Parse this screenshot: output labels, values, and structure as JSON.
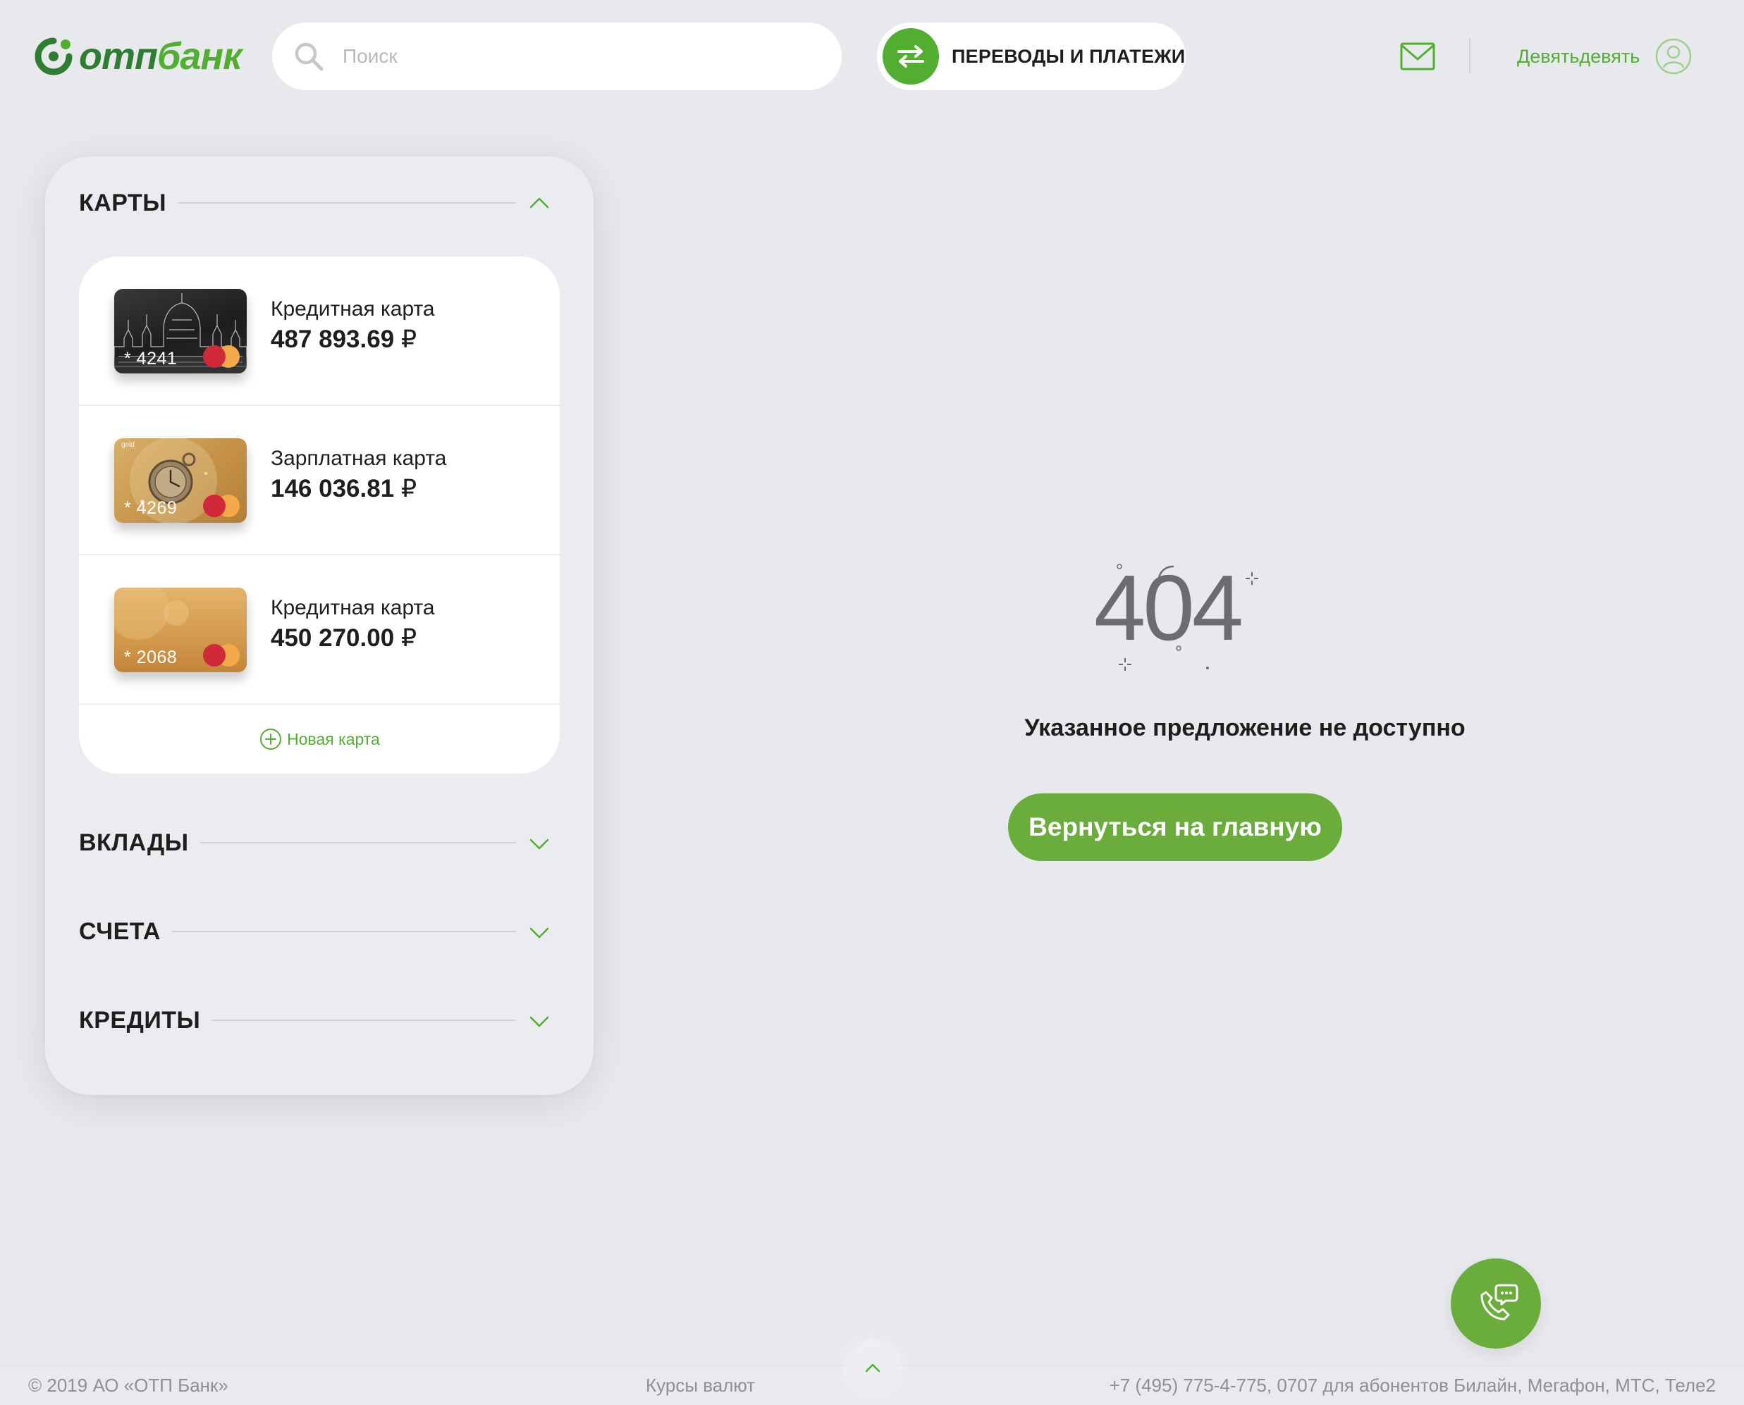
{
  "brand": {
    "logo_part1": "отп",
    "logo_part2": "банк",
    "green": "#52ae30",
    "dark_green": "#2e7d32"
  },
  "header": {
    "search_placeholder": "Поиск",
    "transfers_label": "ПЕРЕВОДЫ И ПЛАТЕЖИ",
    "user_name": "Девятьдевять",
    "icons": [
      "search-icon",
      "transfer-arrows-icon",
      "mail-icon",
      "user-avatar-icon"
    ]
  },
  "sidebar": {
    "cards_title": "КАРТЫ",
    "cards": [
      {
        "name": "Кредитная карта",
        "amount": "487 893.69",
        "currency": "₽",
        "number": "* 4241",
        "style": "dark-parliament"
      },
      {
        "name": "Зарплатная карта",
        "amount": "146 036.81",
        "currency": "₽",
        "number": "* 4269",
        "style": "gold-watch",
        "badge": "gold"
      },
      {
        "name": "Кредитная карта",
        "amount": "450 270.00",
        "currency": "₽",
        "number": "* 2068",
        "style": "gold-plain"
      }
    ],
    "new_card_label": "Новая карта",
    "deposits_title": "ВКЛАДЫ",
    "accounts_title": "СЧЕТА",
    "loans_title": "КРЕДИТЫ"
  },
  "main": {
    "error_code": "404",
    "message": "Указанное предложение не доступно",
    "home_button": "Вернуться на главную"
  },
  "footer": {
    "copyright": "© 2019 АО «ОТП Банк»",
    "rates_link": "Курсы валют",
    "phones": "+7 (495) 775-4-775,  0707 для абонентов Билайн, Мегафон, МТС, Теле2"
  }
}
